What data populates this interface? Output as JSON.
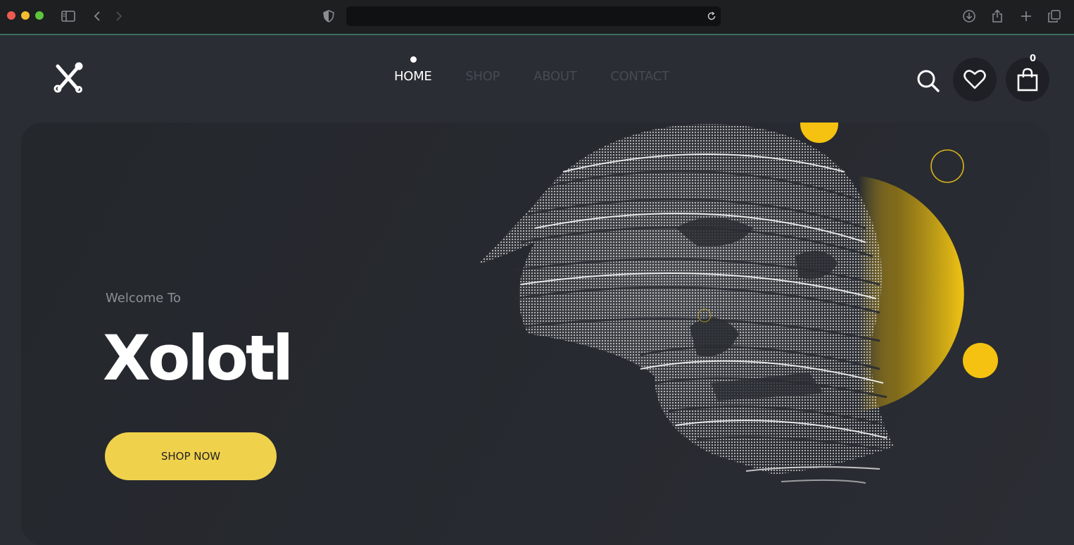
{
  "browser": {
    "address_value": "",
    "icons": [
      "sidebar-icon",
      "back-icon",
      "forward-icon",
      "shield-icon",
      "reload-icon",
      "download-icon",
      "share-icon",
      "new-tab-icon",
      "tabs-overview-icon"
    ]
  },
  "header": {
    "logo_icon": "crossed-tools-icon",
    "nav": [
      {
        "label": "HOME",
        "active": true
      },
      {
        "label": "SHOP",
        "active": false
      },
      {
        "label": "ABOUT",
        "active": false
      },
      {
        "label": "CONTACT",
        "active": false
      }
    ],
    "cart_count": "0",
    "icons": [
      "search-icon",
      "heart-icon",
      "shopping-bag-icon"
    ]
  },
  "hero": {
    "welcome": "Welcome To",
    "brand": "Xolotl",
    "cta": "SHOP NOW",
    "illustration": "point-cloud-face"
  },
  "colors": {
    "accent": "#f0d14c",
    "accent_deep": "#f5c211",
    "background": "#2a2d34",
    "hero": "#25282d"
  }
}
